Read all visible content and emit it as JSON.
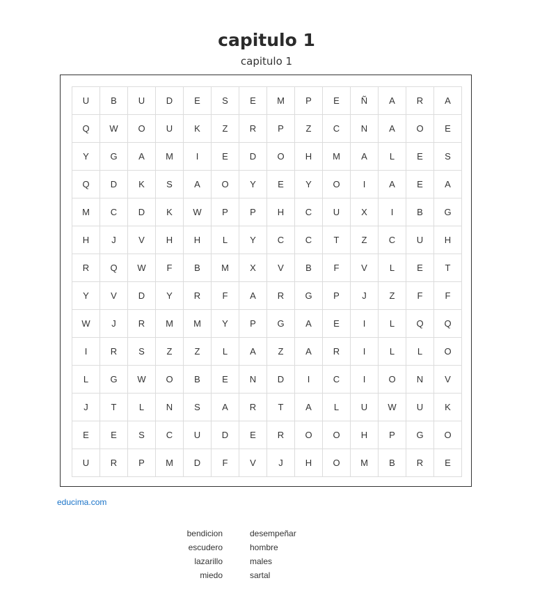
{
  "header": {
    "title": "capitulo 1",
    "subtitle": "capitulo 1"
  },
  "grid": {
    "rows": [
      [
        "U",
        "B",
        "U",
        "D",
        "E",
        "S",
        "E",
        "M",
        "P",
        "E",
        "Ñ",
        "A",
        "R",
        "A"
      ],
      [
        "Q",
        "W",
        "O",
        "U",
        "K",
        "Z",
        "R",
        "P",
        "Z",
        "C",
        "N",
        "A",
        "O",
        "E"
      ],
      [
        "Y",
        "G",
        "A",
        "M",
        "I",
        "E",
        "D",
        "O",
        "H",
        "M",
        "A",
        "L",
        "E",
        "S"
      ],
      [
        "Q",
        "D",
        "K",
        "S",
        "A",
        "O",
        "Y",
        "E",
        "Y",
        "O",
        "I",
        "A",
        "E",
        "A"
      ],
      [
        "M",
        "C",
        "D",
        "K",
        "W",
        "P",
        "P",
        "H",
        "C",
        "U",
        "X",
        "I",
        "B",
        "G"
      ],
      [
        "H",
        "J",
        "V",
        "H",
        "H",
        "L",
        "Y",
        "C",
        "C",
        "T",
        "Z",
        "C",
        "U",
        "H"
      ],
      [
        "R",
        "Q",
        "W",
        "F",
        "B",
        "M",
        "X",
        "V",
        "B",
        "F",
        "V",
        "L",
        "E",
        "T"
      ],
      [
        "Y",
        "V",
        "D",
        "Y",
        "R",
        "F",
        "A",
        "R",
        "G",
        "P",
        "J",
        "Z",
        "F",
        "F"
      ],
      [
        "W",
        "J",
        "R",
        "M",
        "M",
        "Y",
        "P",
        "G",
        "A",
        "E",
        "I",
        "L",
        "Q",
        "Q"
      ],
      [
        "I",
        "R",
        "S",
        "Z",
        "Z",
        "L",
        "A",
        "Z",
        "A",
        "R",
        "I",
        "L",
        "L",
        "O"
      ],
      [
        "L",
        "G",
        "W",
        "O",
        "B",
        "E",
        "N",
        "D",
        "I",
        "C",
        "I",
        "O",
        "N",
        "V"
      ],
      [
        "J",
        "T",
        "L",
        "N",
        "S",
        "A",
        "R",
        "T",
        "A",
        "L",
        "U",
        "W",
        "U",
        "K"
      ],
      [
        "E",
        "E",
        "S",
        "C",
        "U",
        "D",
        "E",
        "R",
        "O",
        "O",
        "H",
        "P",
        "G",
        "O"
      ],
      [
        "U",
        "R",
        "P",
        "M",
        "D",
        "F",
        "V",
        "J",
        "H",
        "O",
        "M",
        "B",
        "R",
        "E"
      ]
    ]
  },
  "footer": {
    "credit": "educima.com"
  },
  "words": {
    "left": [
      "bendicion",
      "escudero",
      "lazarillo",
      "miedo"
    ],
    "right": [
      "desempeñar",
      "hombre",
      "males",
      "sartal"
    ]
  }
}
